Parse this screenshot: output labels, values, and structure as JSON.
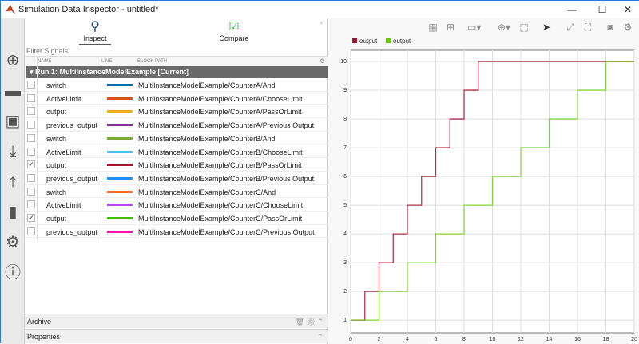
{
  "window": {
    "title": "Simulation Data Inspector - untitled*",
    "minimize": "—",
    "maximize": "☐",
    "close": "✕"
  },
  "sidebar": {
    "icons": [
      "plus-circle-icon",
      "folder-icon",
      "save-icon",
      "download-icon",
      "upload-icon",
      "document-icon",
      "gear-icon",
      "help-icon"
    ]
  },
  "tabs": [
    {
      "label": "Inspect",
      "icon": "search-icon",
      "active": true
    },
    {
      "label": "Compare",
      "icon": "checkbox-icon",
      "active": false
    }
  ],
  "filter_placeholder": "Filter Signals",
  "columns": {
    "name": "NAME",
    "line": "LINE",
    "block_path": "BLOCK PATH"
  },
  "run": "Run 1: MultiInstanceModelExample [Current]",
  "signals": [
    {
      "name": "switch",
      "color": "#0072bd",
      "path": "MultiInstanceModelExample/CounterA/And",
      "checked": false
    },
    {
      "name": "ActiveLimit",
      "color": "#d95319",
      "path": "MultiInstanceModelExample/CounterA/ChooseLimit",
      "checked": false
    },
    {
      "name": "output",
      "color": "#edb120",
      "path": "MultiInstanceModelExample/CounterA/PassOrLimit",
      "checked": false
    },
    {
      "name": "previous_output",
      "color": "#7e2f8e",
      "path": "MultiInstanceModelExample/CounterA/Previous Output",
      "checked": false
    },
    {
      "name": "switch",
      "color": "#77ac30",
      "path": "MultiInstanceModelExample/CounterB/And",
      "checked": false
    },
    {
      "name": "ActiveLimit",
      "color": "#4dbeee",
      "path": "MultiInstanceModelExample/CounterB/ChooseLimit",
      "checked": false
    },
    {
      "name": "output",
      "color": "#a2142f",
      "path": "MultiInstanceModelExample/CounterB/PassOrLimit",
      "checked": true
    },
    {
      "name": "previous_output",
      "color": "#1e90ff",
      "path": "MultiInstanceModelExample/CounterB/Previous Output",
      "checked": false
    },
    {
      "name": "switch",
      "color": "#ff6a29",
      "path": "MultiInstanceModelExample/CounterC/And",
      "checked": false
    },
    {
      "name": "ActiveLimit",
      "color": "#b746ff",
      "path": "MultiInstanceModelExample/CounterC/ChooseLimit",
      "checked": false
    },
    {
      "name": "output",
      "color": "#40c000",
      "path": "MultiInstanceModelExample/CounterC/PassOrLimit",
      "checked": true
    },
    {
      "name": "previous_output",
      "color": "#ff13a6",
      "path": "MultiInstanceModelExample/CounterC/Previous Output",
      "checked": false
    }
  ],
  "archive": "Archive",
  "properties": "Properties",
  "chart_data": {
    "type": "line",
    "xlim": [
      0,
      20
    ],
    "ylim": [
      0.56,
      10.39
    ],
    "xticks": [
      0,
      2,
      4,
      6,
      8,
      10,
      12,
      14,
      16,
      18,
      20
    ],
    "yticks": [
      1,
      2,
      3,
      4,
      5,
      6,
      7,
      8,
      9,
      10
    ],
    "grid": true,
    "legend": "top-left",
    "step": true,
    "series": [
      {
        "name": "output",
        "color": "#a2142f",
        "x": [
          0,
          1,
          2,
          3,
          4,
          5,
          6,
          7,
          8,
          9,
          20
        ],
        "y": [
          1,
          2,
          3,
          4,
          5,
          6,
          7,
          8,
          9,
          10,
          10
        ]
      },
      {
        "name": "output",
        "color": "#66cc00",
        "x": [
          0,
          2,
          4,
          6,
          8,
          10,
          12,
          14,
          16,
          18,
          20
        ],
        "y": [
          1,
          2,
          3,
          4,
          5,
          6,
          7,
          8,
          9,
          10,
          10
        ]
      }
    ]
  }
}
